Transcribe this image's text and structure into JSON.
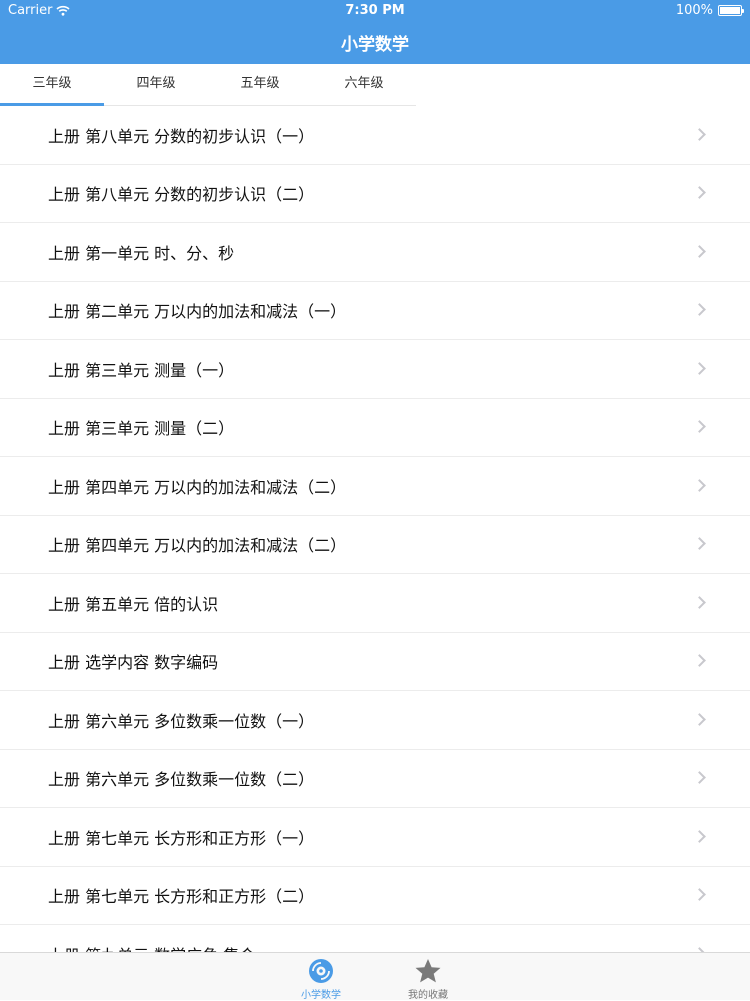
{
  "status_bar": {
    "carrier": "Carrier",
    "time": "7:30 PM",
    "battery": "100%",
    "battery_level": 1.0
  },
  "nav": {
    "title": "小学数学"
  },
  "grade_tabs": [
    {
      "label": "三年级",
      "active": true
    },
    {
      "label": "四年级",
      "active": false
    },
    {
      "label": "五年级",
      "active": false
    },
    {
      "label": "六年级",
      "active": false
    }
  ],
  "lessons": [
    "上册 第八单元 分数的初步认识（一）",
    "上册 第八单元 分数的初步认识（二）",
    "上册 第一单元 时、分、秒",
    "上册 第二单元 万以内的加法和减法（一）",
    "上册 第三单元 测量（一）",
    "上册 第三单元 测量（二）",
    "上册 第四单元 万以内的加法和减法（二）",
    "上册 第四单元 万以内的加法和减法（二）",
    "上册 第五单元 倍的认识",
    "上册 选学内容 数字编码",
    "上册 第六单元 多位数乘一位数（一）",
    "上册 第六单元 多位数乘一位数（二）",
    "上册 第七单元 长方形和正方形（一）",
    "上册 第七单元 长方形和正方形（二）",
    "上册 第九单元 数学广角 集合"
  ],
  "bottom_tabs": [
    {
      "label": "小学数学",
      "icon": "disc-icon",
      "active": true
    },
    {
      "label": "我的收藏",
      "icon": "star-icon",
      "active": false
    }
  ],
  "colors": {
    "accent": "#4a9be6",
    "nav_background": "#4a9be6",
    "chevron": "#c8c8cd"
  }
}
